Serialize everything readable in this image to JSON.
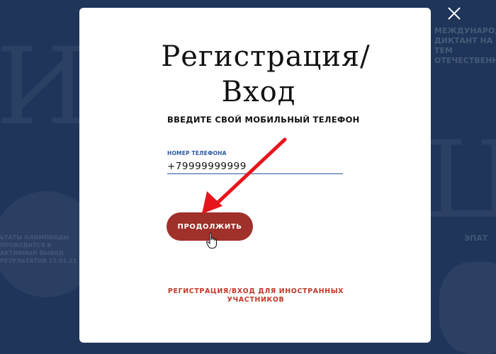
{
  "background": {
    "big_letters_left": "ИЕ",
    "big_letters_right": "Ц",
    "text_left": "ЬТАТЫ ОЛИМПИАДЫ ПРОВОДИТСЯ В АКТИВНЫЙ ВЫВОД РЕЗУЛЬТАТОВ 15.01.21",
    "text_right": "МЕЖДУНАРОДН ДИКТАНТ НА ТЕМ ОТЕЧЕСТВЕННОЙ",
    "text_right2": "ЭПАТ"
  },
  "modal": {
    "title_line1": "Регистрация/",
    "title_line2": "Вход",
    "subtitle": "ВВЕДИТЕ СВОЙ МОБИЛЬНЫЙ ТЕЛЕФОН",
    "phone_label": "НОМЕР ТЕЛЕФОНА",
    "phone_value": "+79999999999",
    "continue_label": "ПРОДОЛЖИТЬ",
    "foreign_link_line1": "РЕГИСТРАЦИЯ/ВХОД ДЛЯ ИНОСТРАННЫХ",
    "foreign_link_line2": "УЧАСТНИКОВ"
  },
  "icons": {
    "close": "close-icon",
    "pointer": "hand-cursor-icon",
    "annotation": "red-arrow-icon"
  },
  "colors": {
    "backdrop": "#1f355a",
    "accent": "#a0302a",
    "link": "#c0392b",
    "field_underline": "#2b5aa3",
    "annotation_arrow": "#e8141c"
  }
}
